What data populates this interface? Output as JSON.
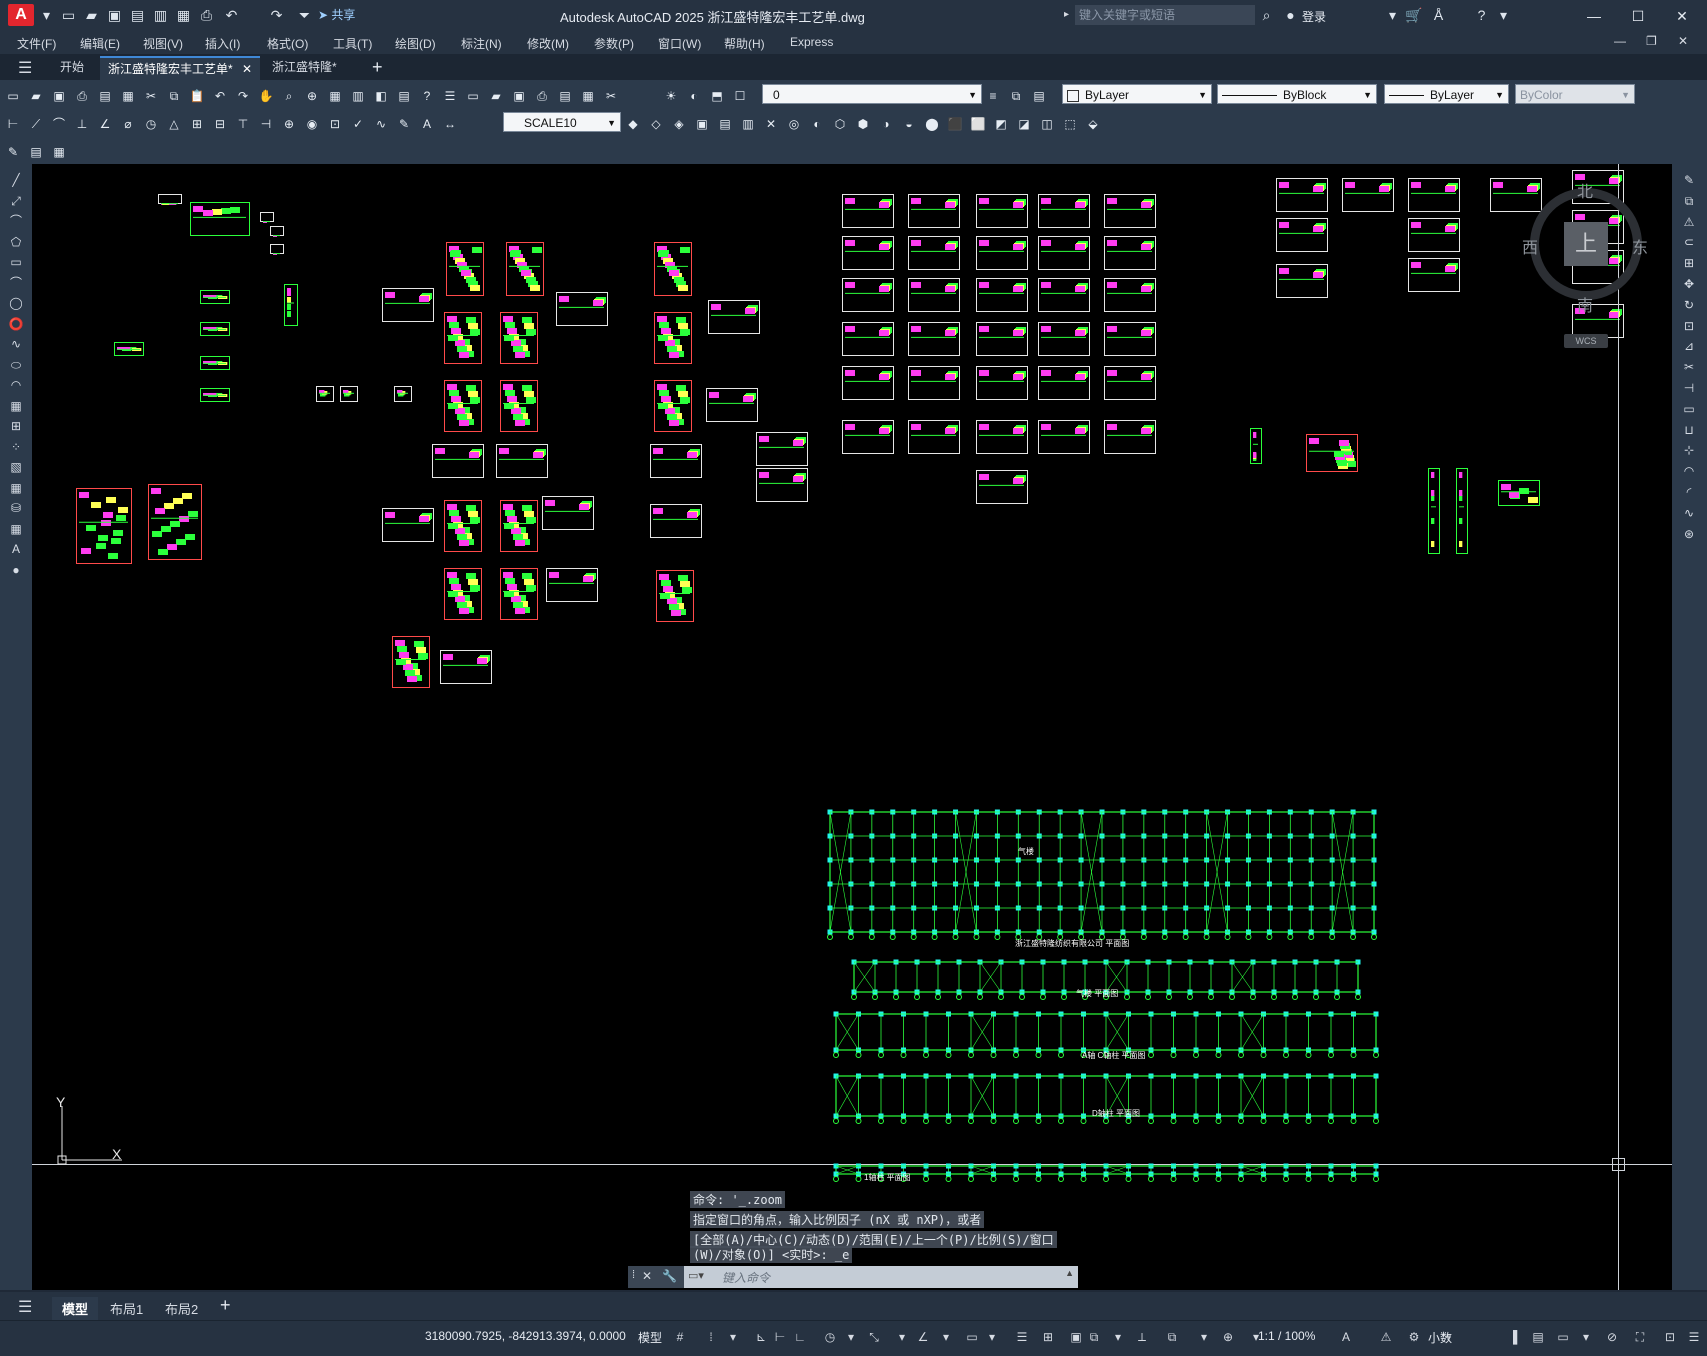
{
  "window": {
    "title": "Autodesk AutoCAD 2025    浙江盛特隆宏丰工艺单.dwg",
    "app_logo": "A",
    "share_label": "共享",
    "search_placeholder": "键入关键字或短语",
    "login_label": "登录"
  },
  "menu": [
    "文件(F)",
    "编辑(E)",
    "视图(V)",
    "插入(I)",
    "格式(O)",
    "工具(T)",
    "绘图(D)",
    "标注(N)",
    "修改(M)",
    "参数(P)",
    "窗口(W)",
    "帮助(H)",
    "Express"
  ],
  "tabs": [
    {
      "label": "开始"
    },
    {
      "label": "浙江盛特隆宏丰工艺单*",
      "active": true
    },
    {
      "label": "浙江盛特隆*"
    }
  ],
  "toolbar": {
    "layer_value": "0",
    "color_value": "ByLayer",
    "linetype_value": "ByBlock",
    "lineweight_value": "ByLayer",
    "plotstyle_value": "ByColor",
    "dimstyle_value": "SCALE10"
  },
  "viewcube": {
    "north": "北",
    "south": "南",
    "east": "东",
    "west": "西",
    "top_face": "上",
    "wcs": "WCS"
  },
  "ucs": {
    "x_label": "X",
    "y_label": "Y"
  },
  "drawing_labels": {
    "plan1": "浙江盛特隆纺织有限公司  平面图",
    "plan1_inner": "气楼",
    "plan2": "气楼  平面图",
    "plan3": "A轴  C轴柱      平面图",
    "plan4": "D轴柱      平面图",
    "plan5": "1轴柱   平面图"
  },
  "command": {
    "history": [
      "命令: '_.zoom",
      "指定窗口的角点，输入比例因子 (nX 或 nXP)，或者",
      "[全部(A)/中心(C)/动态(D)/范围(E)/上一个(P)/比例(S)/窗口",
      "(W)/对象(O)] <实时>: _e"
    ],
    "input_placeholder": "键入命令"
  },
  "layout_tabs": [
    {
      "label": "模型",
      "active": true
    },
    {
      "label": "布局1"
    },
    {
      "label": "布局2"
    }
  ],
  "status": {
    "coordinates": "3180090.7925, -842913.3974, 0.0000",
    "space": "模型",
    "scale": "1:1 / 100%",
    "units": "小数"
  }
}
